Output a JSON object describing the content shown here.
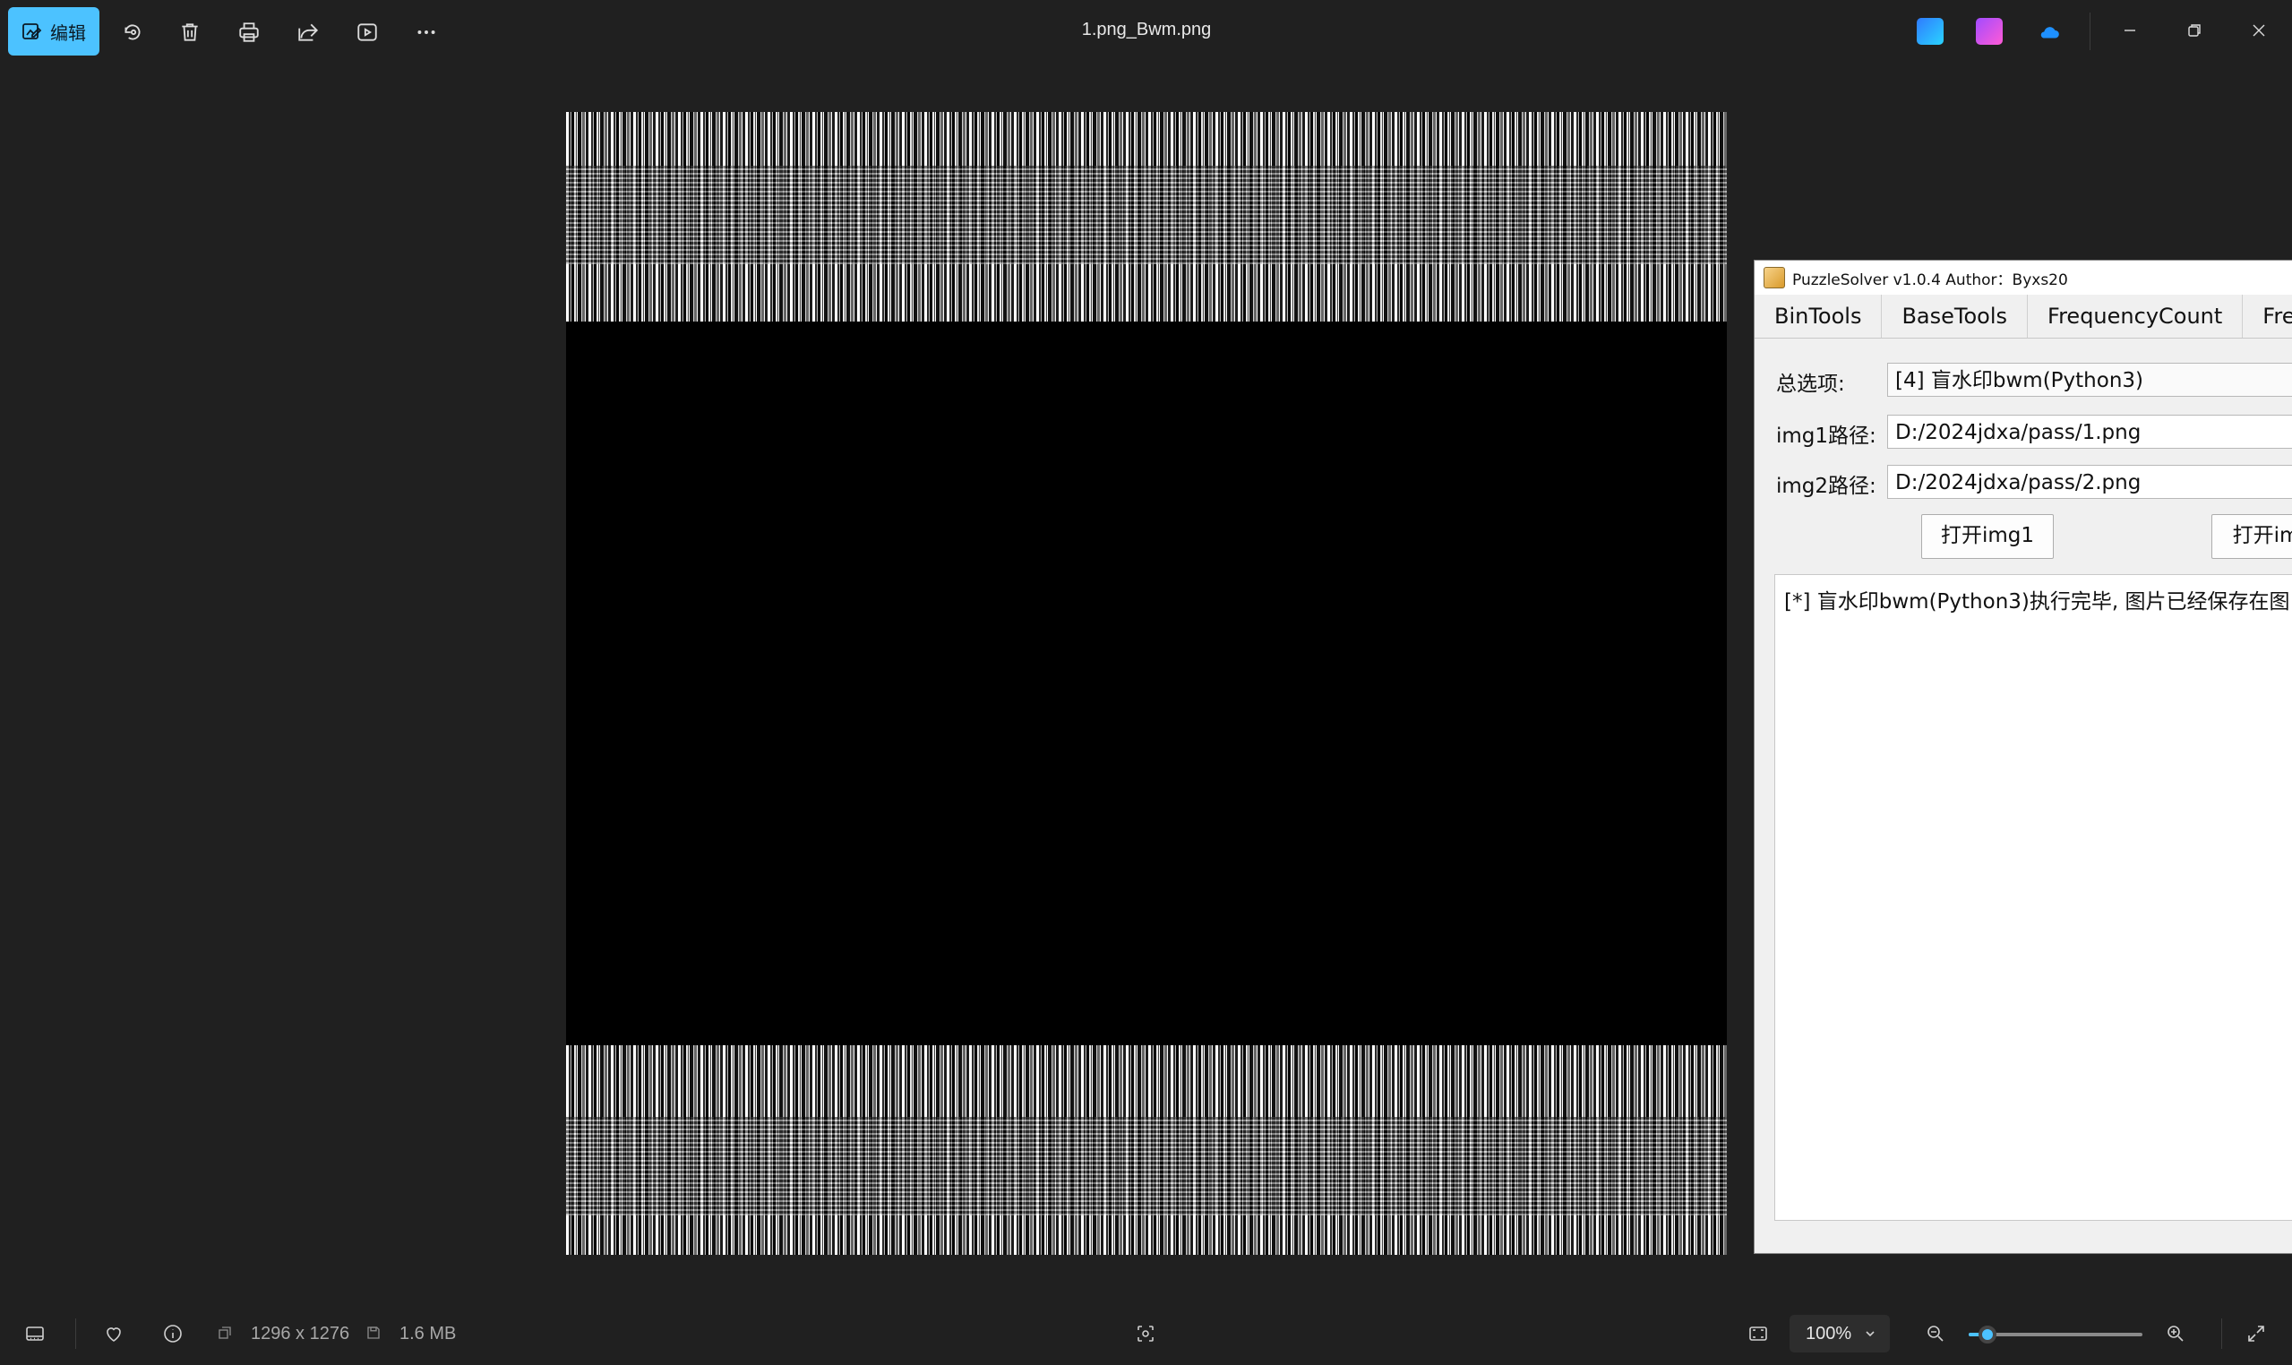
{
  "toolbar": {
    "edit_label": "编辑",
    "file_title": "1.png_Bwm.png"
  },
  "puzzle_solver": {
    "title": "PuzzleSolver v1.0.4  Author：Byxs20",
    "tabs": [
      "BinTools",
      "BaseTools",
      "FrequencyCount",
      "Fre"
    ],
    "option_label": "总选项:",
    "option_value": "[4] 盲水印bwm(Python3)",
    "img1_label": "img1路径:",
    "img1_value": "D:/2024jdxa/pass/1.png",
    "img2_label": "img2路径:",
    "img2_value": "D:/2024jdxa/pass/2.png",
    "open_img1_label": "打开img1",
    "open_img2_label": "打开im",
    "output_text": "[*] 盲水印bwm(Python3)执行完毕, 图片已经保存在图"
  },
  "status_bar": {
    "dimensions": "1296 x 1276",
    "file_size": "1.6 MB",
    "zoom": "100%",
    "zoom_slider_fraction": 0.11
  },
  "colors": {
    "accent": "#4cc2ff",
    "background": "#202020"
  }
}
